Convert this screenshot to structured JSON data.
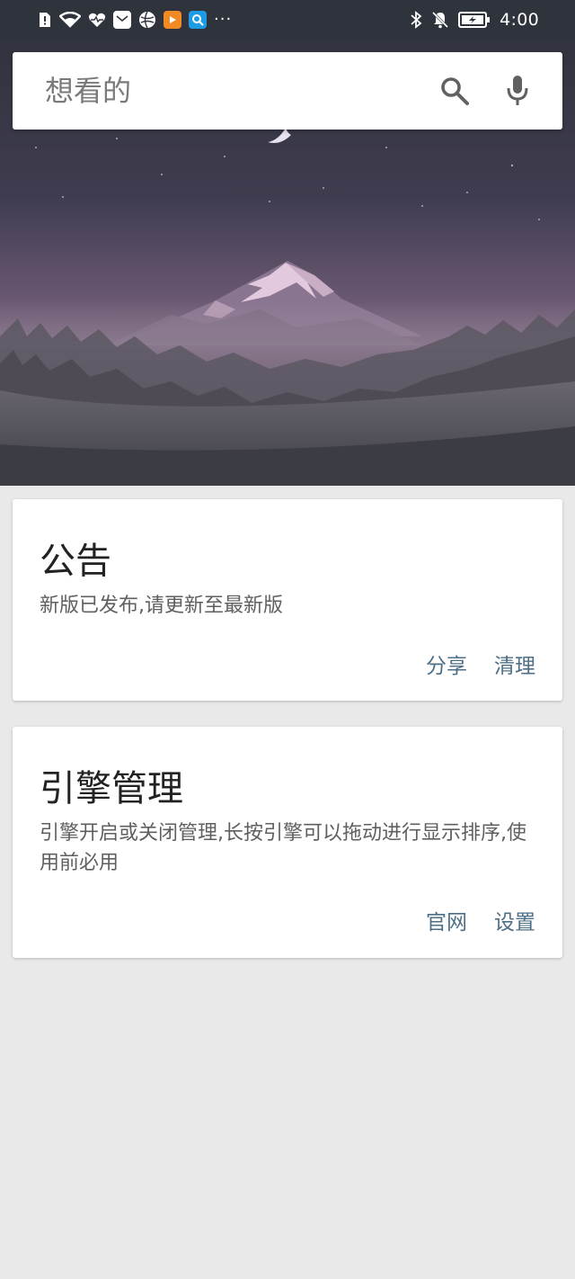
{
  "status_bar": {
    "time": "4:00",
    "more": "···",
    "icons_left": [
      "alert-icon",
      "wifi-icon",
      "health-icon",
      "mail-icon",
      "browser-icon",
      "video-app-icon",
      "search-app-icon"
    ],
    "icons_right": [
      "bluetooth-icon",
      "mute-icon",
      "battery-icon"
    ]
  },
  "search": {
    "placeholder": "想看的"
  },
  "cards": {
    "announce": {
      "title": "公告",
      "desc": "新版已发布,请更新至最新版",
      "actions": [
        "分享",
        "清理"
      ]
    },
    "engine": {
      "title": "引擎管理",
      "desc": "引擎开启或关闭管理,长按引擎可以拖动进行显示排序,使用前必用",
      "actions": [
        "官网",
        "设置"
      ]
    }
  },
  "colors": {
    "accent": "#4e6f86",
    "status_bar": "#2e333c",
    "background": "#e9e9e9"
  }
}
